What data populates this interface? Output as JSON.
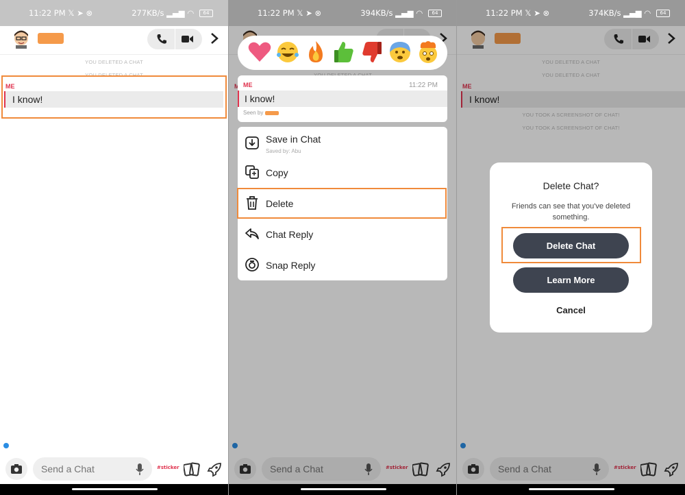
{
  "status": {
    "p1": {
      "time": "11:22 PM",
      "speed": "277KB/s",
      "battery": "64"
    },
    "p2": {
      "time": "11:22 PM",
      "speed": "394KB/s",
      "battery": "64"
    },
    "p3": {
      "time": "11:22 PM",
      "speed": "374KB/s",
      "battery": "64"
    }
  },
  "chat": {
    "sys_deleted": "YOU DELETED A CHAT",
    "sys_screenshot": "YOU TOOK A SCREENSHOT OF CHAT!",
    "sender": "ME",
    "message": "I know!",
    "time": "11:22 PM",
    "seen_by": "Seen by"
  },
  "composer": {
    "placeholder": "Send a Chat",
    "sticker_label": "#sticker"
  },
  "reactions": [
    "heart",
    "tears-of-joy",
    "fire",
    "thumbs-up",
    "thumbs-down",
    "anxious-face",
    "exploding-head"
  ],
  "menu": {
    "save": {
      "label": "Save in Chat",
      "sub": "Saved by: Abu"
    },
    "copy": {
      "label": "Copy"
    },
    "delete": {
      "label": "Delete"
    },
    "chat_reply": {
      "label": "Chat Reply"
    },
    "snap_reply": {
      "label": "Snap Reply"
    }
  },
  "dialog": {
    "title": "Delete Chat?",
    "body": "Friends can see that you've deleted something.",
    "delete_button": "Delete Chat",
    "learn_more_button": "Learn More",
    "cancel_button": "Cancel"
  },
  "colors": {
    "accent_red": "#e0334e",
    "highlight_orange": "#f08a3a",
    "dark_button": "#3e4450",
    "blue_dot": "#2a8de3"
  }
}
